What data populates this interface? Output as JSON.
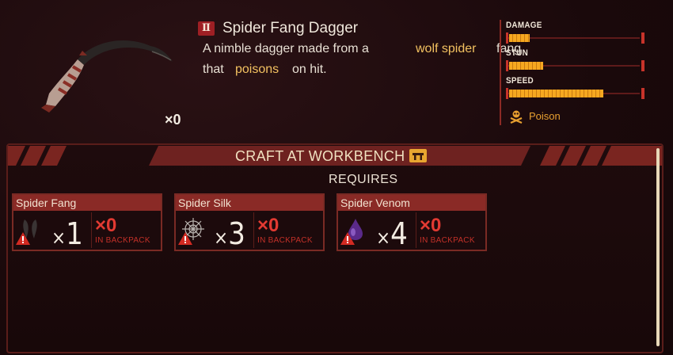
{
  "item": {
    "tier": "Ⅱ",
    "title": "Spider Fang Dagger",
    "description_parts": [
      "A nimble dagger made from a",
      "wolf spider",
      "fang",
      "that",
      "poisons",
      "on hit."
    ],
    "owned_count": "×0",
    "icon": "dagger-icon"
  },
  "stats": {
    "damage_label": "DAMAGE",
    "stun_label": "STUN",
    "speed_label": "SPEED",
    "damage_fill": 0.16,
    "stun_fill": 0.26,
    "speed_fill": 0.72,
    "effect_label": "Poison",
    "effect_icon": "poison-icon"
  },
  "craft": {
    "title": "CRAFT AT WORKBENCH",
    "requires": "REQUIRES",
    "ingredients": [
      {
        "name": "Spider Fang",
        "required": "1",
        "owned": "0",
        "owned_note": "IN BACKPACK",
        "icon": "spider-fang-icon"
      },
      {
        "name": "Spider Silk",
        "required": "3",
        "owned": "0",
        "owned_note": "IN BACKPACK",
        "icon": "spider-silk-icon"
      },
      {
        "name": "Spider Venom",
        "required": "4",
        "owned": "0",
        "owned_note": "IN BACKPACK",
        "icon": "spider-venom-icon"
      }
    ]
  },
  "colors": {
    "accent_red": "#9e1f24",
    "highlight_gold": "#f2c160",
    "stat_fill": "#f6a820",
    "warning_red": "#e23a32"
  }
}
